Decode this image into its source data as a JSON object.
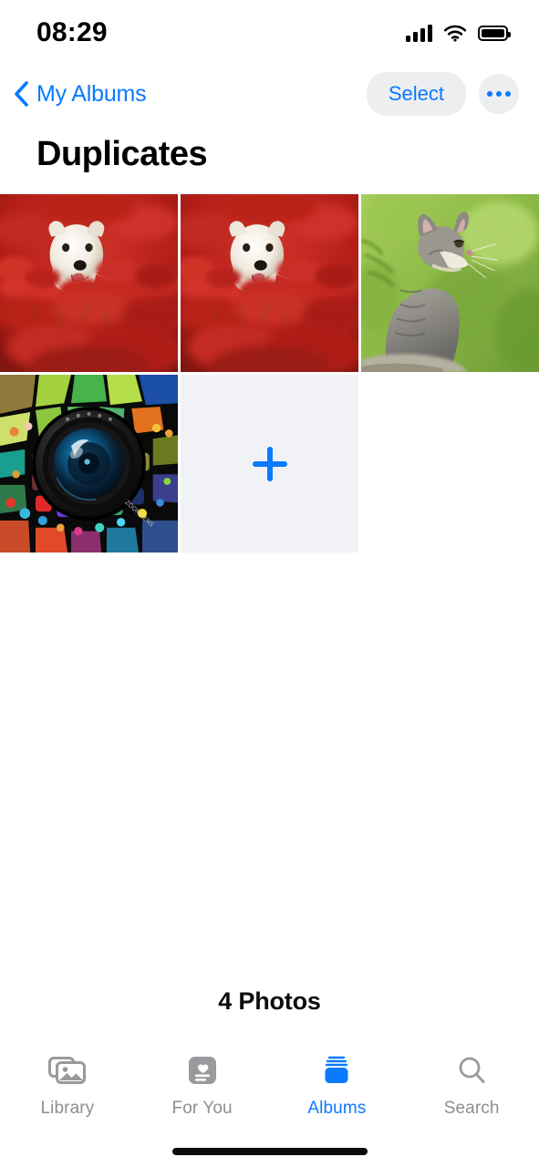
{
  "status_bar": {
    "time": "08:29",
    "signal_icon": "cellular-signal-icon",
    "wifi_icon": "wifi-icon",
    "battery_icon": "battery-full-icon"
  },
  "nav_bar": {
    "back_icon": "chevron-left-icon",
    "back_label": "My Albums",
    "select_label": "Select",
    "more_icon": "ellipsis-icon"
  },
  "page_title": "Duplicates",
  "grid": {
    "tiles": [
      {
        "name": "photo-dog-in-red-flowers-1",
        "alt": "White dog in a field of red spider lilies",
        "type": "photo"
      },
      {
        "name": "photo-dog-in-red-flowers-2",
        "alt": "White dog in a field of red spider lilies (duplicate)",
        "type": "photo"
      },
      {
        "name": "photo-kitten-in-grass",
        "alt": "Grey tabby kitten looking up with green grass background",
        "type": "photo"
      },
      {
        "name": "photo-camera-lens-mosaic",
        "alt": "Camera lens surrounded by a colorful mosaic",
        "type": "photo"
      },
      {
        "name": "add-photo-tile",
        "alt": "Add photo",
        "type": "add",
        "icon": "plus-icon"
      }
    ]
  },
  "footer": {
    "photo_count": "4 Photos"
  },
  "tab_bar": {
    "tabs": [
      {
        "label": "Library",
        "icon": "photo-stack-icon",
        "active": false
      },
      {
        "label": "For You",
        "icon": "heart-card-icon",
        "active": false
      },
      {
        "label": "Albums",
        "icon": "albums-stack-icon",
        "active": true
      },
      {
        "label": "Search",
        "icon": "magnifier-icon",
        "active": false
      }
    ]
  },
  "home_indicator": "home-indicator",
  "colors": {
    "accent": "#0a7aff",
    "inactive": "#8e8e93",
    "chip_bg": "#eceef0",
    "add_tile_bg": "#f1f2f6",
    "text": "#000000"
  }
}
